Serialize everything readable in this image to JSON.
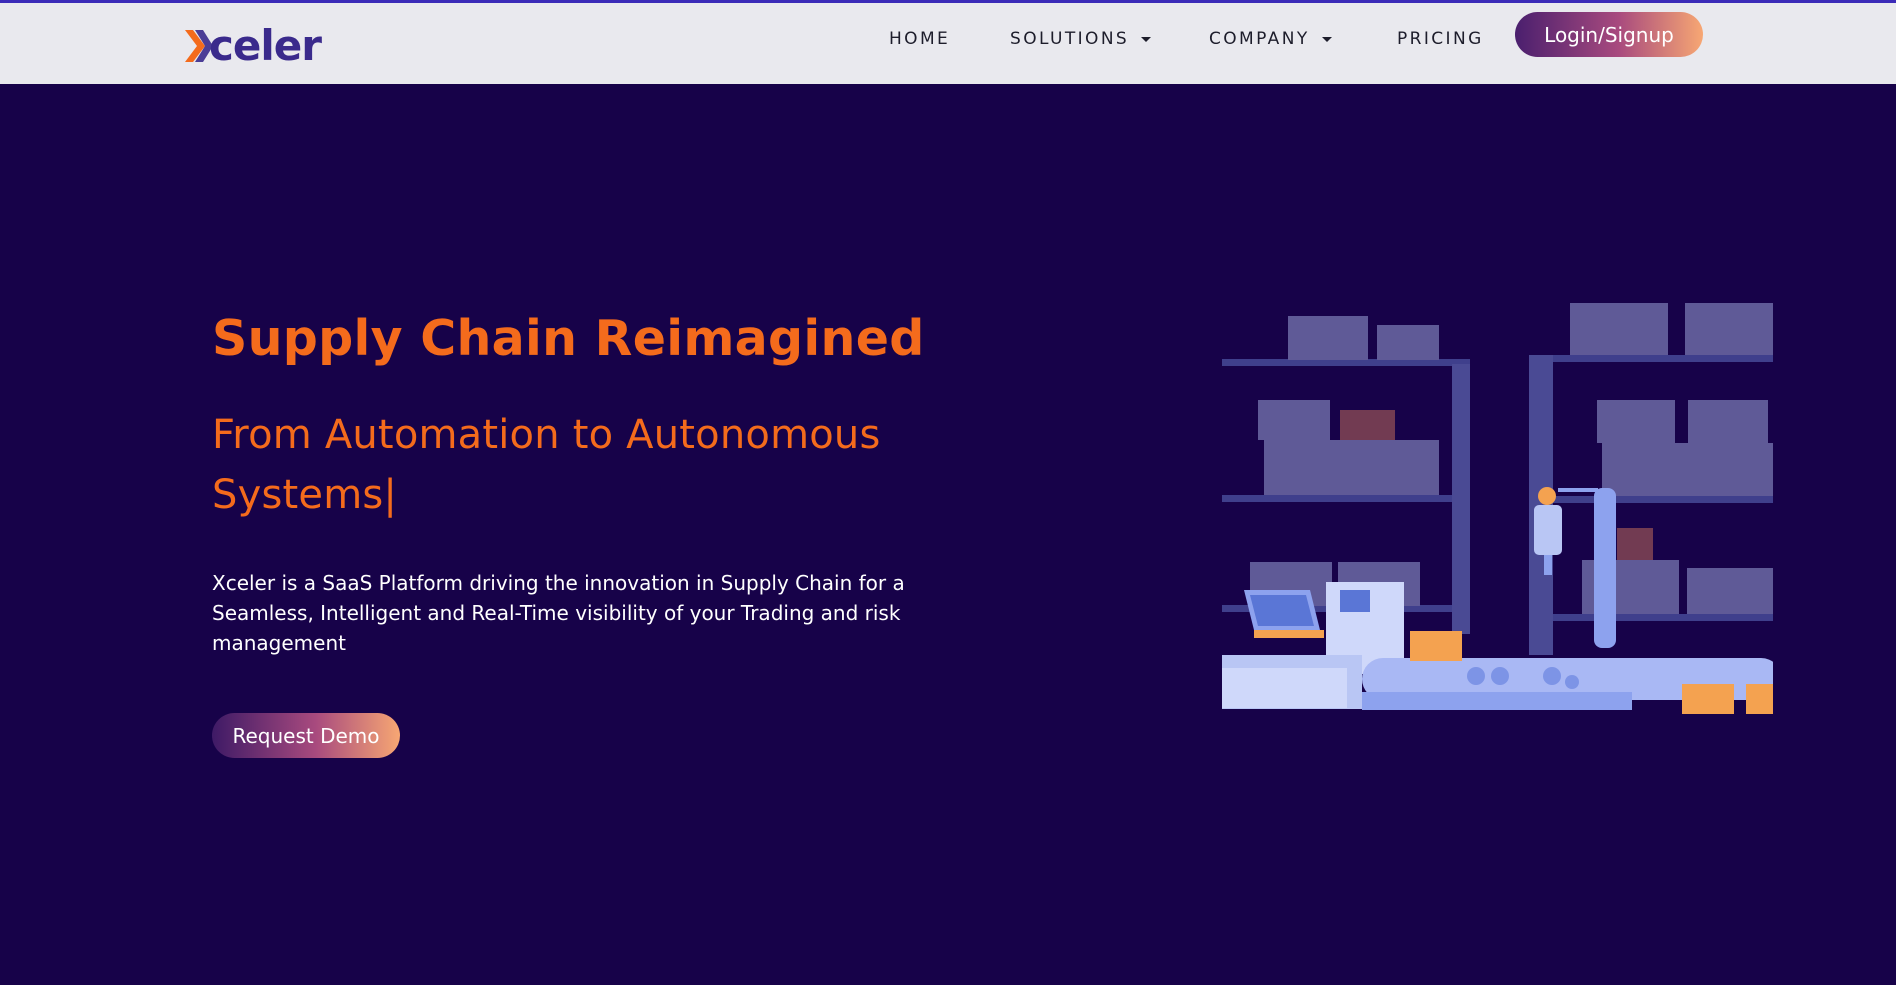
{
  "brand": {
    "name": "celer",
    "logo_letter": "X",
    "logo_alt": "Xceler"
  },
  "nav": {
    "items": [
      {
        "label": "HOME"
      },
      {
        "label": "SOLUTIONS"
      },
      {
        "label": "COMPANY"
      },
      {
        "label": "PRICING"
      }
    ],
    "login_label": "Login/Signup"
  },
  "hero": {
    "title": "Supply Chain Reimagined",
    "subtitle": "From Automation to Autonomous Systems|",
    "description": "Xceler is a SaaS Platform driving the innovation in Supply Chain for a Seamless, Intelligent and Real-Time visibility of your Trading and risk management",
    "cta_label": "Request Demo"
  },
  "colors": {
    "background": "#170249",
    "accent_orange": "#f46b1c",
    "navbar": "#e9e9ee",
    "brand_purple": "#3a2a8c"
  },
  "icons": {
    "logo": "xceler-logo-icon",
    "dropdown": "caret-down-icon",
    "illustration": "warehouse-automation-illustration"
  }
}
